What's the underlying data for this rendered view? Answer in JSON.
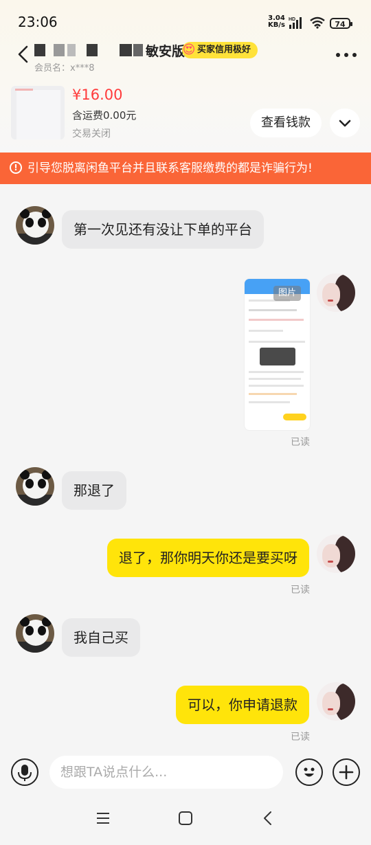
{
  "status": {
    "time": "23:06",
    "net_speed": "3.04",
    "net_unit": "KB/s",
    "net_type": "HD",
    "battery": "74"
  },
  "header": {
    "nickname_suffix": "敏安版",
    "member_label": "会员名：x***8",
    "credit_badge": "买家信用极好"
  },
  "product": {
    "price": "¥16.00",
    "shipping": "含运费0.00元",
    "status": "交易关闭",
    "view_button": "查看钱款"
  },
  "warning": {
    "text": "引导您脱离闲鱼平台并且联系客服缴费的都是诈骗行为!"
  },
  "messages": [
    {
      "side": "in",
      "text": "第一次见还有没让下单的平台"
    },
    {
      "side": "out",
      "type": "image",
      "tag": "图片",
      "read": "已读"
    },
    {
      "side": "in",
      "text": "那退了"
    },
    {
      "side": "out",
      "text": "退了，那你明天你还是要买呀",
      "read": "已读"
    },
    {
      "side": "in",
      "text": "我自己买"
    },
    {
      "side": "out",
      "text": "可以，你申请退款",
      "read": "已读"
    }
  ],
  "input": {
    "placeholder": "想跟TA说点什么..."
  },
  "icons": {
    "back": "back-arrow-icon",
    "more": "more-dots-icon",
    "expand": "chevron-down-icon",
    "warning": "warning-circle-icon",
    "mic": "microphone-icon",
    "emoji": "emoji-icon",
    "plus": "plus-icon",
    "nav_menu": "menu-icon",
    "nav_home": "home-square-icon",
    "nav_back": "nav-back-icon"
  },
  "colors": {
    "accent_yellow": "#ffe40a",
    "warning_bg": "#fa6537",
    "price_red": "#ff3b3b"
  }
}
